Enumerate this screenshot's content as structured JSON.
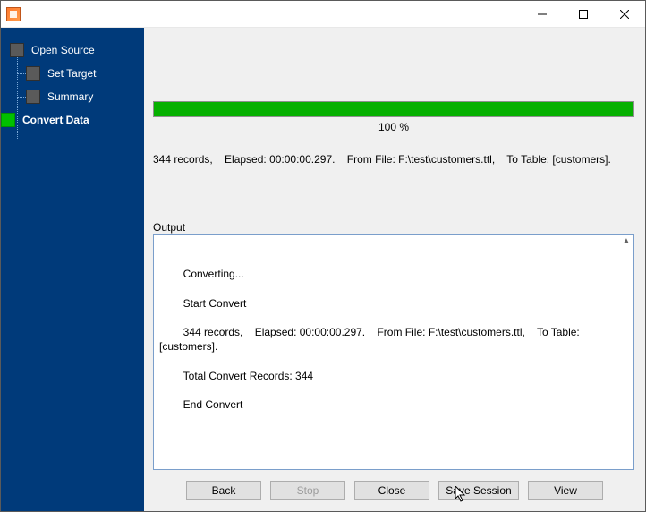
{
  "sidebar": {
    "items": [
      {
        "label": "Open Source",
        "active": false
      },
      {
        "label": "Set Target",
        "active": false
      },
      {
        "label": "Summary",
        "active": false
      },
      {
        "label": "Convert Data",
        "active": true
      }
    ]
  },
  "progress": {
    "percent_text": "100 %",
    "fill_percent": 100
  },
  "status_line": "344 records,    Elapsed: 00:00:00.297.    From File: F:\\test\\customers.ttl,    To Table: [customers].",
  "output": {
    "label": "Output",
    "lines": [
      "Converting...",
      "Start Convert",
      "344 records,    Elapsed: 00:00:00.297.    From File: F:\\test\\customers.ttl,    To Table: [customers].",
      "Total Convert Records: 344",
      "End Convert"
    ]
  },
  "buttons": {
    "back": "Back",
    "stop": "Stop",
    "close": "Close",
    "save_session": "Save Session",
    "view": "View"
  }
}
